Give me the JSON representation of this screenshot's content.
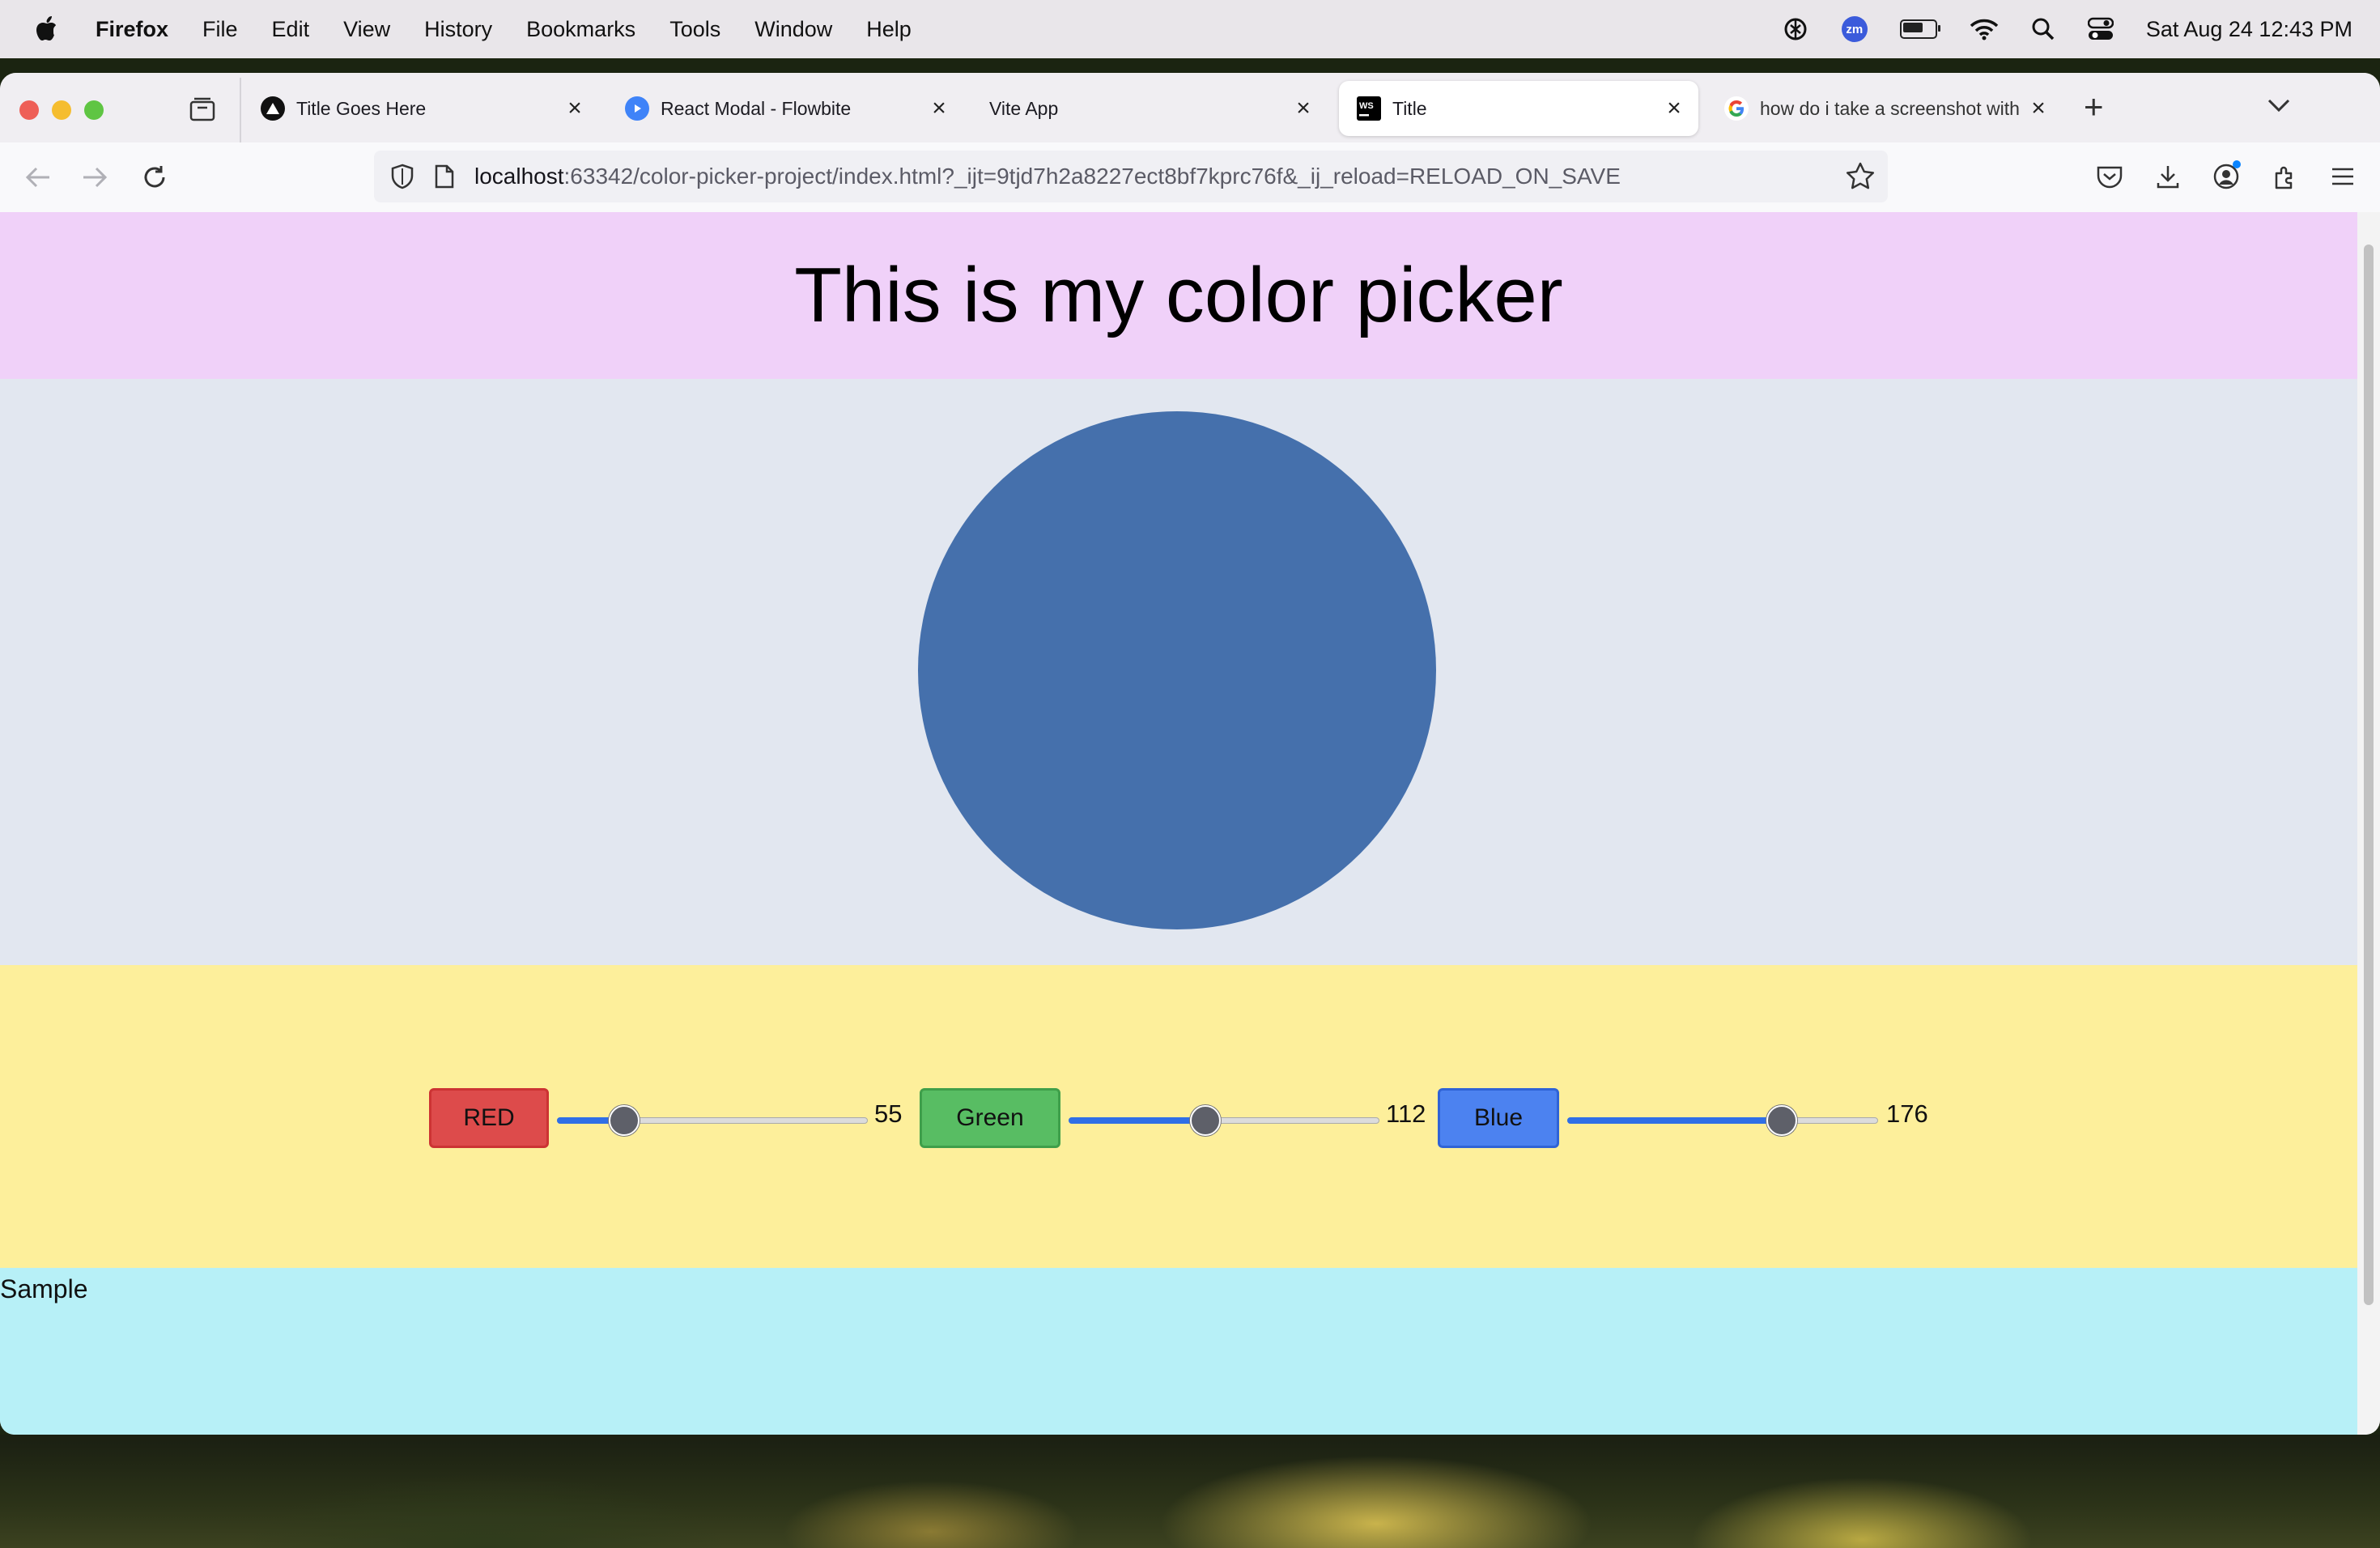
{
  "menubar": {
    "app": "Firefox",
    "items": [
      "File",
      "Edit",
      "View",
      "History",
      "Bookmarks",
      "Tools",
      "Window",
      "Help"
    ],
    "zoom_badge": "zm",
    "clock": "Sat Aug 24  12:43 PM"
  },
  "tabs": [
    {
      "label": "Title Goes Here",
      "icon": "triangle-logo-icon"
    },
    {
      "label": "React Modal - Flowbite",
      "icon": "flowbite-icon"
    },
    {
      "label": "Vite App",
      "icon": ""
    },
    {
      "label": "Title",
      "icon": "webstorm-icon",
      "active": true
    },
    {
      "label": "how do i take a screenshot with",
      "icon": "google-icon"
    }
  ],
  "url": {
    "host": "localhost",
    "rest": ":63342/color-picker-project/index.html?_ijt=9tjd7h2a8227ect8bf7kprc76f&_ij_reload=RELOAD_ON_SAVE"
  },
  "page": {
    "title": "This is my color picker",
    "circle_color": "#4570ac",
    "sample_label": "Sample"
  },
  "controls": {
    "red": {
      "label": "RED",
      "value": "55",
      "fraction": 0.216
    },
    "green": {
      "label": "Green",
      "value": "112",
      "fraction": 0.439
    },
    "blue": {
      "label": "Blue",
      "value": "176",
      "fraction": 0.69
    }
  }
}
